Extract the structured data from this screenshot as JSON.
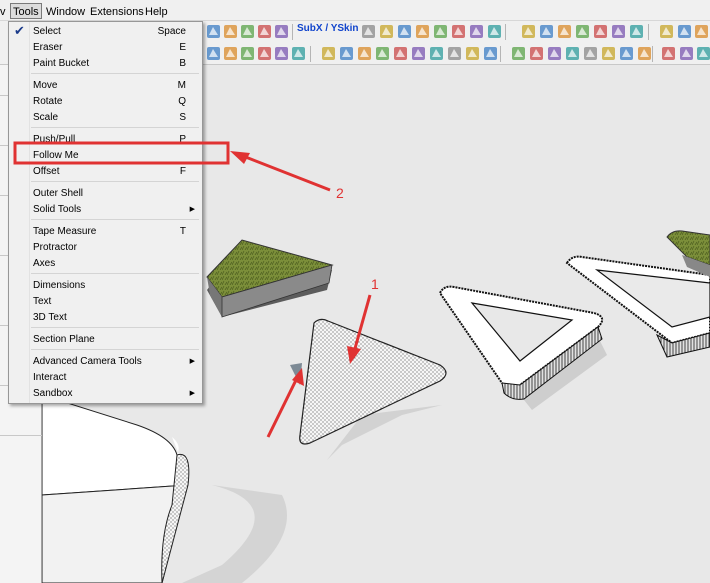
{
  "menubar": {
    "items": [
      "v",
      "Tools",
      "Window",
      "Extensions",
      "Help"
    ],
    "active": "Tools"
  },
  "toolbar": {
    "label_text": "SubX / YSkin"
  },
  "tools_menu": {
    "items": [
      {
        "label": "Select",
        "shortcut": "Space",
        "checked": true
      },
      {
        "label": "Eraser",
        "shortcut": "E"
      },
      {
        "label": "Paint Bucket",
        "shortcut": "B"
      },
      {
        "label": "Move",
        "shortcut": "M"
      },
      {
        "label": "Rotate",
        "shortcut": "Q"
      },
      {
        "label": "Scale",
        "shortcut": "S"
      },
      {
        "label": "Push/Pull",
        "shortcut": "P"
      },
      {
        "label": "Follow Me",
        "shortcut": "",
        "highlighted": true
      },
      {
        "label": "Offset",
        "shortcut": "F"
      },
      {
        "label": "Outer Shell",
        "shortcut": ""
      },
      {
        "label": "Solid Tools",
        "shortcut": "",
        "submenu": true
      },
      {
        "label": "Tape Measure",
        "shortcut": "T"
      },
      {
        "label": "Protractor",
        "shortcut": ""
      },
      {
        "label": "Axes",
        "shortcut": ""
      },
      {
        "label": "Dimensions",
        "shortcut": ""
      },
      {
        "label": "Text",
        "shortcut": ""
      },
      {
        "label": "3D Text",
        "shortcut": ""
      },
      {
        "label": "Section Plane",
        "shortcut": ""
      },
      {
        "label": "Advanced Camera Tools",
        "shortcut": "",
        "submenu": true
      },
      {
        "label": "Interact",
        "shortcut": ""
      },
      {
        "label": "Sandbox",
        "shortcut": "",
        "submenu": true
      }
    ]
  },
  "annotations": {
    "label_1": "1",
    "label_2": "2",
    "color": "#e03232"
  },
  "icons": [
    "checkmark-icon",
    "submenu-arrow-icon",
    "toolbar-tool-icon"
  ]
}
